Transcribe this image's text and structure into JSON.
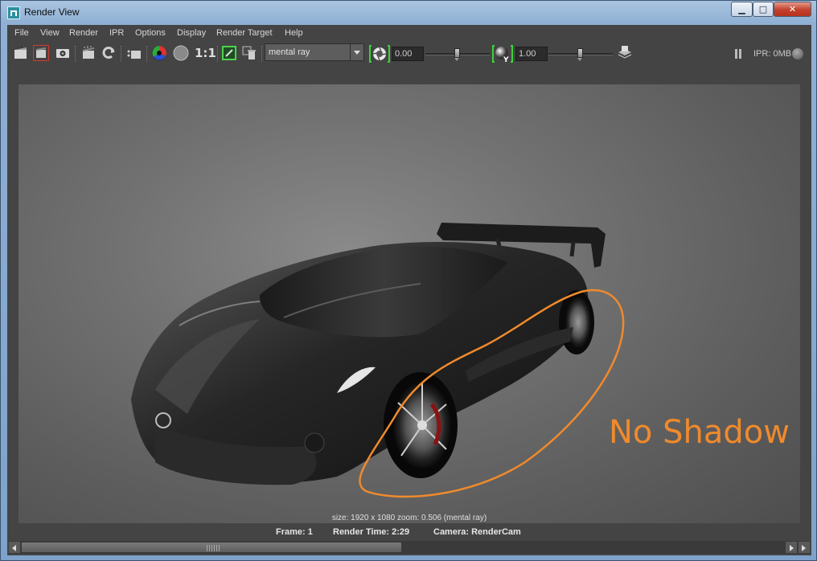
{
  "window": {
    "title": "Render View"
  },
  "menu": [
    "File",
    "View",
    "Render",
    "IPR",
    "Options",
    "Display",
    "Render Target",
    "Help"
  ],
  "toolbar": {
    "ratio_label": "1:1",
    "renderer": "mental ray",
    "exposure": "0.00",
    "gamma": "1.00",
    "ipr_status": "IPR: 0MB"
  },
  "viewport": {
    "annotation": "No Shadow :(",
    "annotation_color": "#f08a2c",
    "info": "size: 1920 x 1080 zoom: 0.506      (mental ray)"
  },
  "status": {
    "frame": "Frame: 1",
    "render_time": "Render Time:  2:29",
    "camera": "Camera: RenderCam"
  }
}
